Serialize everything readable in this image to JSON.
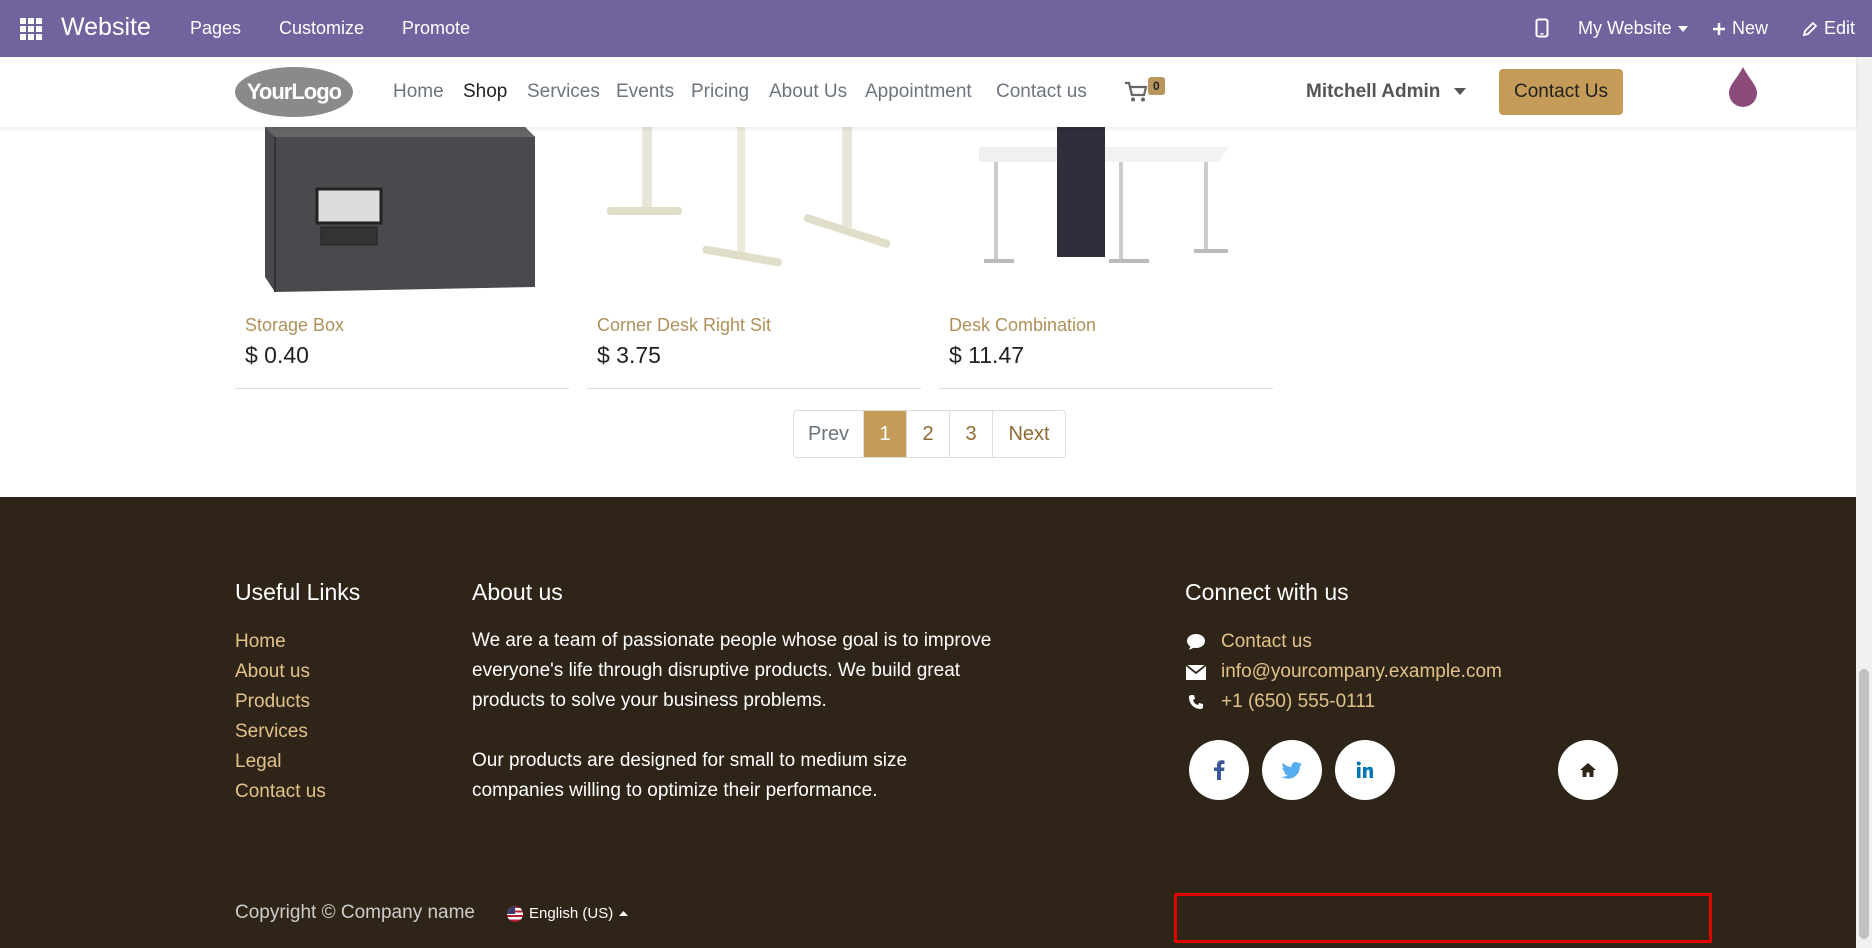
{
  "admin_bar": {
    "title": "Website",
    "menu": [
      "Pages",
      "Customize",
      "Promote"
    ],
    "site_selector": "My Website",
    "new_label": "New",
    "edit_label": "Edit"
  },
  "header": {
    "logo_text": "YourLogo",
    "nav": [
      "Home",
      "Shop",
      "Services",
      "Events",
      "Pricing",
      "About Us",
      "Appointment",
      "Contact us"
    ],
    "cart_count": "0",
    "user": "Mitchell Admin",
    "cta": "Contact Us"
  },
  "products": [
    {
      "name": "Storage Box",
      "price": "$ 0.40"
    },
    {
      "name": "Corner Desk Right Sit",
      "price": "$ 3.75"
    },
    {
      "name": "Desk Combination",
      "price": "$ 11.47"
    }
  ],
  "pagination": {
    "prev": "Prev",
    "pages": [
      "1",
      "2",
      "3"
    ],
    "current": "1",
    "next": "Next"
  },
  "footer": {
    "useful_links_title": "Useful Links",
    "useful_links": [
      "Home",
      "About us",
      "Products",
      "Services",
      "Legal",
      "Contact us"
    ],
    "about_title": "About us",
    "about_p1_lines": [
      "We are a team of passionate people whose goal is to improve",
      "everyone's life through disruptive products. We build great",
      "products to solve your business problems."
    ],
    "about_p2_lines": [
      "Our products are designed for small to medium size",
      "companies willing to optimize their performance."
    ],
    "connect_title": "Connect with us",
    "contact_link": "Contact us",
    "email": "info@yourcompany.example.com",
    "phone": "+1 (650) 555-0111",
    "copyright": "Copyright © Company name",
    "language": "English (US)"
  }
}
